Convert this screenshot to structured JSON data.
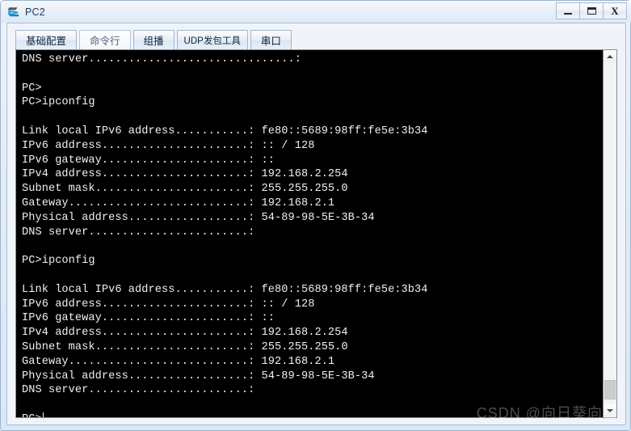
{
  "window": {
    "title": "PC2",
    "icon": "pc-device-icon",
    "buttons": {
      "minimize": "minimize-button",
      "maximize": "maximize-button",
      "close": "X"
    }
  },
  "tabs": [
    {
      "label": "基础配置",
      "selected": false
    },
    {
      "label": "命令行",
      "selected": true
    },
    {
      "label": "组播",
      "selected": false
    },
    {
      "label": "UDP发包工具",
      "selected": false
    },
    {
      "label": "串口",
      "selected": false
    }
  ],
  "terminal": {
    "lines": [
      "DNS server...............................:",
      "",
      "PC>",
      "PC>ipconfig",
      "",
      "Link local IPv6 address...........: fe80::5689:98ff:fe5e:3b34",
      "IPv6 address......................: :: / 128",
      "IPv6 gateway......................: ::",
      "IPv4 address......................: 192.168.2.254",
      "Subnet mask.......................: 255.255.255.0",
      "Gateway...........................: 192.168.2.1",
      "Physical address..................: 54-89-98-5E-3B-34",
      "DNS server........................:",
      "",
      "PC>ipconfig",
      "",
      "Link local IPv6 address...........: fe80::5689:98ff:fe5e:3b34",
      "IPv6 address......................: :: / 128",
      "IPv6 gateway......................: ::",
      "IPv4 address......................: 192.168.2.254",
      "Subnet mask.......................: 255.255.255.0",
      "Gateway...........................: 192.168.2.1",
      "Physical address..................: 54-89-98-5E-3B-34",
      "DNS server........................:",
      "",
      "PC>"
    ],
    "prompt_cursor": true,
    "foreground_color": "#f0f0f0",
    "background_color": "#000000"
  },
  "scrollbar": {
    "up_arrow": "scroll-up-arrow",
    "down_arrow": "scroll-down-arrow",
    "thumb": "scroll-thumb"
  },
  "watermark": {
    "text": "CSDN @向日葵向日"
  }
}
